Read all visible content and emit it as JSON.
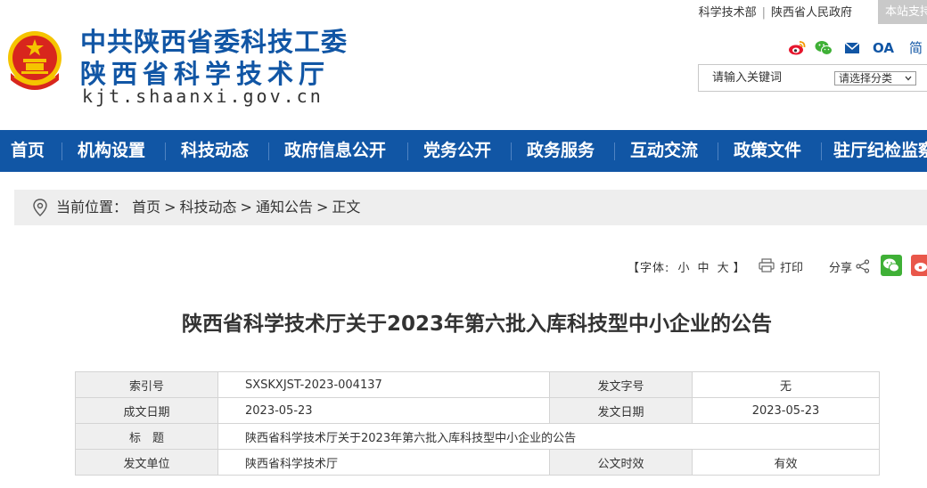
{
  "header": {
    "site_name_line1": "中共陕西省委科技工委",
    "site_name_line2": "陕西省科学技术厅",
    "domain": "kjt.shaanxi.gov.cn",
    "top_links": [
      "科学技术部",
      "陕西省人民政府"
    ],
    "assist_button": "本站支持",
    "oa_label": "OA",
    "lang_label": "简",
    "search_placeholder": "请输入关键词",
    "category_select": "请选择分类"
  },
  "nav": {
    "items": [
      "首页",
      "机构设置",
      "科技动态",
      "政府信息公开",
      "党务公开",
      "政务服务",
      "互动交流",
      "政策文件",
      "驻厅纪检监察"
    ]
  },
  "breadcrumb": {
    "label": "当前位置：",
    "items": [
      "首页",
      "科技动态",
      "通知公告",
      "正文"
    ],
    "separator": ">"
  },
  "tools": {
    "font_open": "【字体:",
    "font_small": "小",
    "font_medium": "中",
    "font_large": "大",
    "font_close": "】",
    "print": "打印",
    "share": "分享"
  },
  "article": {
    "title": "陕西省科学技术厅关于2023年第六批入库科技型中小企业的公告",
    "meta": {
      "index_label": "索引号",
      "index_value": "SXSKXJST-2023-004137",
      "doc_no_label": "发文字号",
      "doc_no_value": "无",
      "created_label": "成文日期",
      "created_value": "2023-05-23",
      "issued_label": "发文日期",
      "issued_value": "2023-05-23",
      "title_label": "标　题",
      "title_value": "陕西省科学技术厅关于2023年第六批入库科技型中小企业的公告",
      "issuer_label": "发文单位",
      "issuer_value": "陕西省科学技术厅",
      "validity_label": "公文时效",
      "validity_value": "有效"
    }
  },
  "colors": {
    "brand_blue": "#1156a5",
    "emblem_red": "#d8261d",
    "emblem_gold": "#f5c400"
  },
  "icons": [
    "national-emblem-icon",
    "weibo-icon",
    "wechat-icon",
    "mail-icon",
    "location-pin-icon",
    "print-icon",
    "share-icon"
  ]
}
